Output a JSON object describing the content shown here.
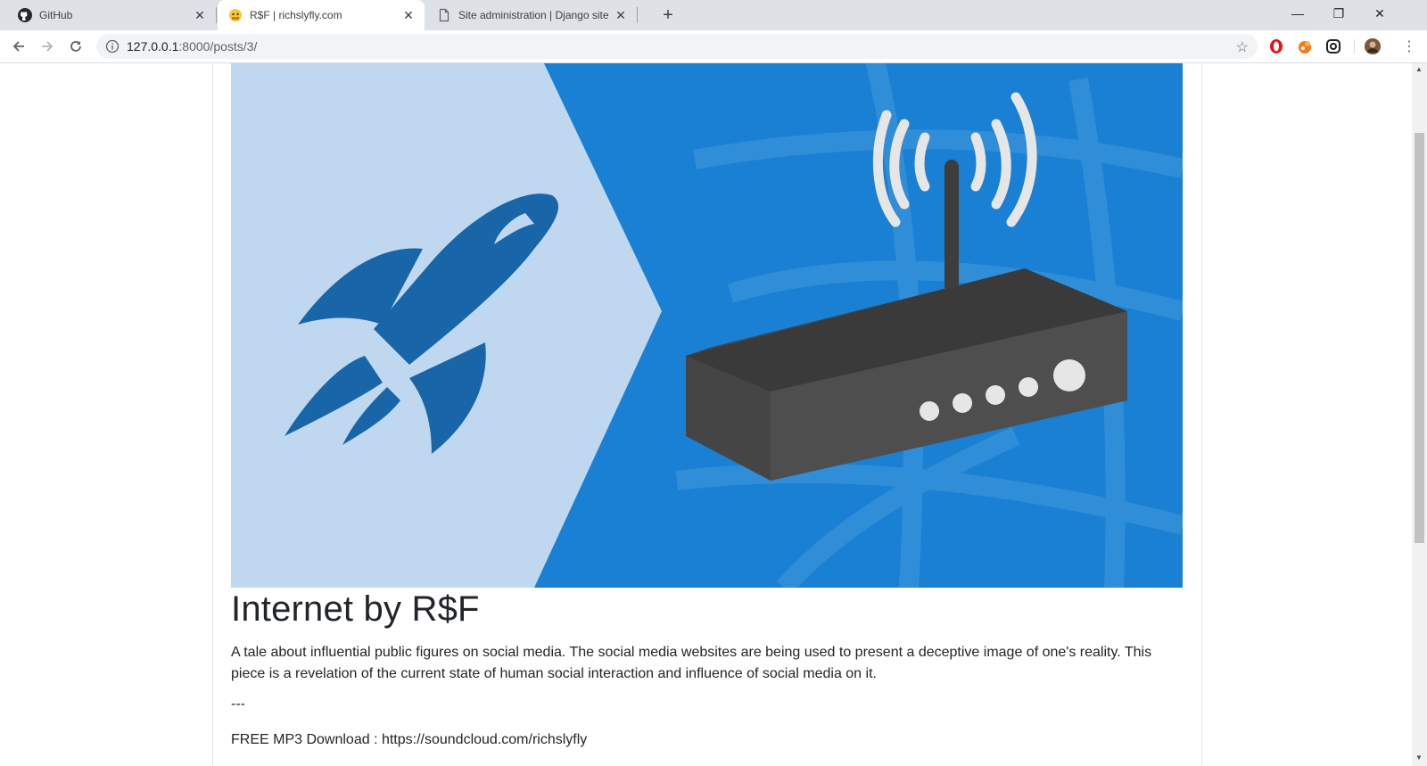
{
  "browser": {
    "tabs": [
      {
        "label": "GitHub",
        "close": "✕"
      },
      {
        "label": "R$F | richslyfly.com",
        "close": "✕"
      },
      {
        "label": "Site administration | Django site",
        "close": "✕"
      }
    ],
    "new_tab": "+",
    "window_controls": {
      "minimize": "—",
      "restore": "❐",
      "close": "✕"
    },
    "url_host": "127.0.0.1",
    "url_rest": ":8000/posts/3/",
    "star": "☆",
    "menu": "⋮"
  },
  "post": {
    "title": "Internet by R$F",
    "body": "A tale about influential public figures on social media. The social media websites are being used to present a deceptive image of one's reality. This piece is a revelation of the current state of human social interaction and influence of social media on it.",
    "separator": "---",
    "download": "FREE MP3 Download : https://soundcloud.com/richslyfly"
  },
  "colors": {
    "hero_light": "#bfd8f0",
    "hero_blue": "#1980d3",
    "rocket": "#1866a8",
    "router": "#3d3d3d"
  },
  "icons": [
    "github-icon",
    "tab-favicon-icon",
    "document-icon",
    "back-icon",
    "forward-icon",
    "reload-icon",
    "info-icon",
    "star-icon",
    "opera-icon",
    "extension-icon",
    "sync-icon",
    "profile-avatar",
    "kebab-menu-icon"
  ]
}
